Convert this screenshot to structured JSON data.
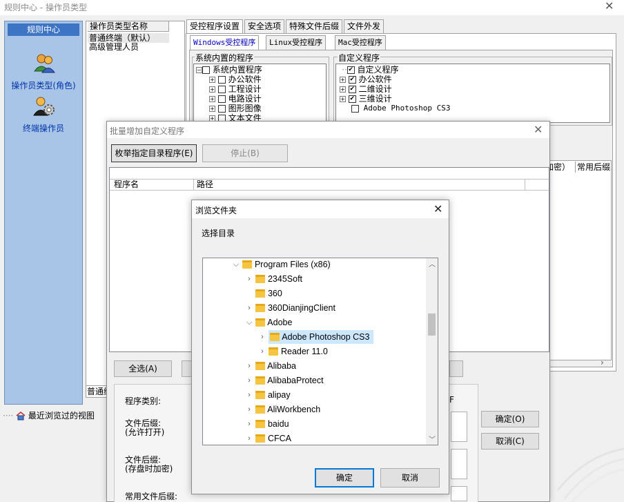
{
  "main_window": {
    "title": "规则中心 - 操作员类型",
    "close_glyph": "✕"
  },
  "nav": {
    "header": "规则中心",
    "items": [
      {
        "label": "操作员类型(角色)",
        "icon": "users-icon"
      },
      {
        "label": "终端操作员",
        "icon": "user-gear-icon"
      }
    ]
  },
  "role_list": {
    "header": "操作员类型名称",
    "rows": [
      "普通终端（默认）",
      "高级管理人员"
    ],
    "bottom_row": "普通终"
  },
  "recent_views": "最近浏览过的视图",
  "tabs": [
    "受控程序设置",
    "安全选项",
    "特殊文件后缀",
    "文件外发"
  ],
  "subtabs": [
    "Windows受控程序",
    "Linux受控程序",
    "Mac受控程序"
  ],
  "builtin_group": {
    "title": "系统内置的程序",
    "root": "系统内置程序",
    "children": [
      "办公软件",
      "工程设计",
      "电路设计",
      "图形图像",
      "文本文件"
    ]
  },
  "custom_group": {
    "title": "自定义程序",
    "root": "自定义程序",
    "children": [
      "办公软件",
      "二维设计",
      "三维设计"
    ],
    "leaf": "Adobe Photoshop CS3"
  },
  "background_columns": [
    "加密）",
    "常用后缀"
  ],
  "batch_dialog": {
    "title": "批量增加自定义程序",
    "close_glyph": "✕",
    "enum_button": "枚举指定目录程序(E)",
    "stop_button": "停止(B)",
    "columns": [
      "程序名",
      "路径"
    ],
    "select_all": "全选(A)",
    "labels": {
      "category": "程序类别:",
      "suffix_open": "文件后缀:",
      "suffix_open_hint": "(允许打开)",
      "suffix_save": "文件后缀:",
      "suffix_save_hint": "(存盘时加密)",
      "common_suffix": "常用文件后缀:"
    },
    "ok_button": "确定(O)",
    "cancel_button": "取消(C)",
    "right_char": "F"
  },
  "browse_dialog": {
    "title": "浏览文件夹",
    "close_glyph": "✕",
    "prompt": "选择目录",
    "folders": [
      {
        "name": "Program Files (x86)",
        "level": 0,
        "state": "expanded"
      },
      {
        "name": "2345Soft",
        "level": 1,
        "state": "collapsed"
      },
      {
        "name": "360",
        "level": 1,
        "state": "none"
      },
      {
        "name": "360DianjingClient",
        "level": 1,
        "state": "collapsed"
      },
      {
        "name": "Adobe",
        "level": 1,
        "state": "expanded"
      },
      {
        "name": "Adobe Photoshop CS3",
        "level": 2,
        "state": "collapsed",
        "selected": true
      },
      {
        "name": "Reader 11.0",
        "level": 2,
        "state": "collapsed"
      },
      {
        "name": "Alibaba",
        "level": 1,
        "state": "collapsed"
      },
      {
        "name": "AlibabaProtect",
        "level": 1,
        "state": "collapsed"
      },
      {
        "name": "alipay",
        "level": 1,
        "state": "collapsed"
      },
      {
        "name": "AliWorkbench",
        "level": 1,
        "state": "collapsed"
      },
      {
        "name": "baidu",
        "level": 1,
        "state": "collapsed"
      },
      {
        "name": "CFCA",
        "level": 1,
        "state": "collapsed"
      }
    ],
    "ok_button": "确定",
    "cancel_button": "取消"
  },
  "colors": {
    "nav_bg": "#a8c5e8",
    "nav_header": "#3d74c4",
    "selection": "#cce8ff",
    "focus_border": "#0078d7"
  }
}
